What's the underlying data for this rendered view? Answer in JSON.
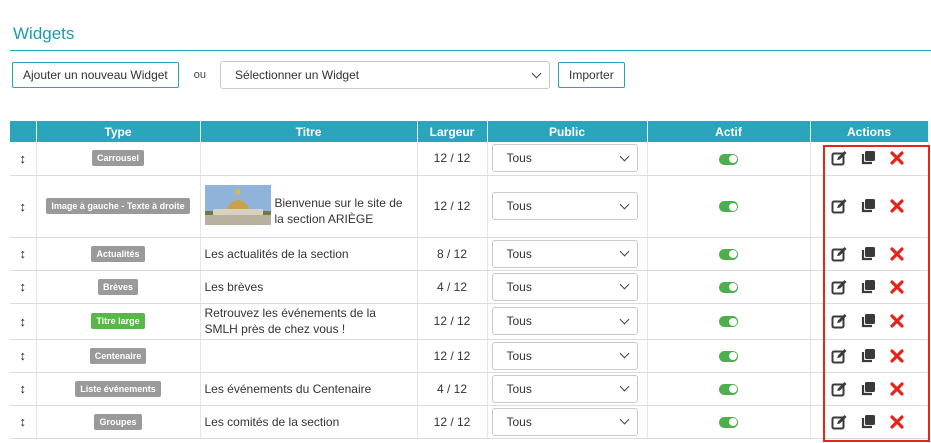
{
  "page": {
    "title": "Widgets"
  },
  "toolbar": {
    "add_label": "Ajouter un nouveau Widget",
    "ou_label": "ou",
    "select_label": "Sélectionner un Widget",
    "import_label": "Importer"
  },
  "table": {
    "headers": [
      "",
      "Type",
      "Titre",
      "Largeur",
      "Public",
      "Actif",
      "Actions"
    ],
    "rows": [
      {
        "type": "Carrousel",
        "titre": "",
        "largeur": "12 / 12",
        "public": "Tous",
        "actif": true
      },
      {
        "type": "Image à gauche - Texte à droite",
        "titre": "Bienvenue sur le site de la section ARIÈGE",
        "largeur": "12 / 12",
        "public": "Tous",
        "actif": true,
        "image": "dome-photo"
      },
      {
        "type": "Actualités",
        "titre": "Les actualités de la section",
        "largeur": "8 / 12",
        "public": "Tous",
        "actif": true
      },
      {
        "type": "Brèves",
        "titre": "Les brèves",
        "largeur": "4 / 12",
        "public": "Tous",
        "actif": true
      },
      {
        "type": "Titre large",
        "titre": "Retrouvez les événements de la SMLH près de chez vous !",
        "largeur": "12 / 12",
        "public": "Tous",
        "actif": true,
        "highlight": true
      },
      {
        "type": "Centenaire",
        "titre": "",
        "largeur": "12 / 12",
        "public": "Tous",
        "actif": true
      },
      {
        "type": "Liste événements",
        "titre": "Les événements du Centenaire",
        "largeur": "4 / 12",
        "public": "Tous",
        "actif": true
      },
      {
        "type": "Groupes",
        "titre": "Les comités de la section",
        "largeur": "12 / 12",
        "public": "Tous",
        "actif": true
      }
    ]
  },
  "colors": {
    "accent": "#2aa5bb",
    "title": "#1f9bb1",
    "badge_gray": "#9a9a9a",
    "badge_green": "#57b847",
    "toggle_on": "#4cae4c",
    "delete_red": "#e5231b",
    "highlight_box": "#e0281e"
  },
  "icons": {
    "drag": "vertical-arrows-icon",
    "edit": "edit-icon",
    "duplicate": "copy-icon",
    "delete": "close-icon",
    "select": "chevron-down-icon"
  }
}
